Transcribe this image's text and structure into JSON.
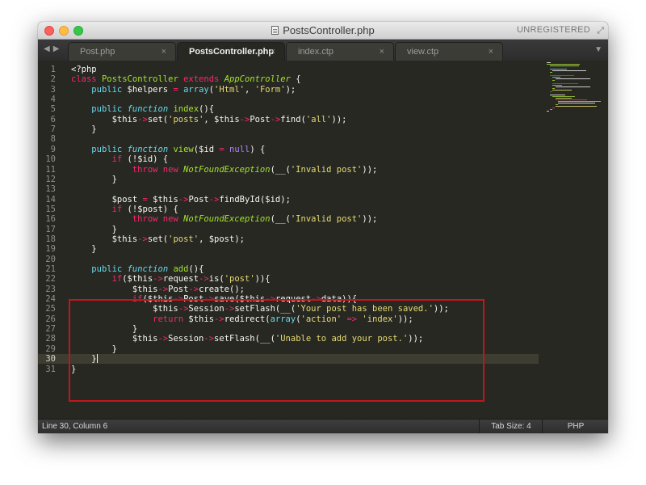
{
  "window": {
    "title": "PostsController.php",
    "license_status": "UNREGISTERED"
  },
  "tabs": [
    {
      "label": "Post.php",
      "close": "×",
      "active": false
    },
    {
      "label": "PostsController.php",
      "close": "×",
      "active": true
    },
    {
      "label": "index.ctp",
      "close": "×",
      "active": false
    },
    {
      "label": "view.ctp",
      "close": "×",
      "active": false
    }
  ],
  "editor": {
    "current_line": 30,
    "lines": [
      {
        "n": "1",
        "c": "<?php"
      },
      {
        "n": "2",
        "c": "class PostsController extends AppController {"
      },
      {
        "n": "3",
        "c": "    public $helpers = array('Html', 'Form');"
      },
      {
        "n": "4",
        "c": ""
      },
      {
        "n": "5",
        "c": "    public function index(){"
      },
      {
        "n": "6",
        "c": "        $this->set('posts', $this->Post->find('all'));"
      },
      {
        "n": "7",
        "c": "    }"
      },
      {
        "n": "8",
        "c": ""
      },
      {
        "n": "9",
        "c": "    public function view($id = null) {"
      },
      {
        "n": "10",
        "c": "        if (!$id) {"
      },
      {
        "n": "11",
        "c": "            throw new NotFoundException(__('Invalid post'));"
      },
      {
        "n": "12",
        "c": "        }"
      },
      {
        "n": "13",
        "c": ""
      },
      {
        "n": "14",
        "c": "        $post = $this->Post->findById($id);"
      },
      {
        "n": "15",
        "c": "        if (!$post) {"
      },
      {
        "n": "16",
        "c": "            throw new NotFoundException(__('Invalid post'));"
      },
      {
        "n": "17",
        "c": "        }"
      },
      {
        "n": "18",
        "c": "        $this->set('post', $post);"
      },
      {
        "n": "19",
        "c": "    }"
      },
      {
        "n": "20",
        "c": ""
      },
      {
        "n": "21",
        "c": "    public function add(){"
      },
      {
        "n": "22",
        "c": "        if($this->request->is('post')){"
      },
      {
        "n": "23",
        "c": "            $this->Post->create();"
      },
      {
        "n": "24",
        "c": "            if($this->Post->save($this->request->data)){"
      },
      {
        "n": "25",
        "c": "                $this->Session->setFlash(__('Your post has been saved.'));"
      },
      {
        "n": "26",
        "c": "                return $this->redirect(array('action' => 'index'));"
      },
      {
        "n": "27",
        "c": "            }"
      },
      {
        "n": "28",
        "c": "            $this->Session->setFlash(__('Unable to add your post.'));"
      },
      {
        "n": "29",
        "c": "        }"
      },
      {
        "n": "30",
        "c": "    }"
      },
      {
        "n": "31",
        "c": "}"
      }
    ]
  },
  "status_bar": {
    "position": "Line 30, Column 6",
    "tab_size": "Tab Size: 4",
    "syntax": "PHP"
  },
  "colors": {
    "background": "#272822",
    "keyword": "#f92672",
    "storage": "#66d9ef",
    "function": "#a6e22e",
    "string": "#e6db74",
    "highlight_box": "#c0161c"
  },
  "icons": [
    "close-window-icon",
    "minimize-window-icon",
    "zoom-window-icon",
    "document-icon",
    "fullscreen-icon",
    "tab-nav-arrows-icon",
    "tab-menu-icon"
  ]
}
